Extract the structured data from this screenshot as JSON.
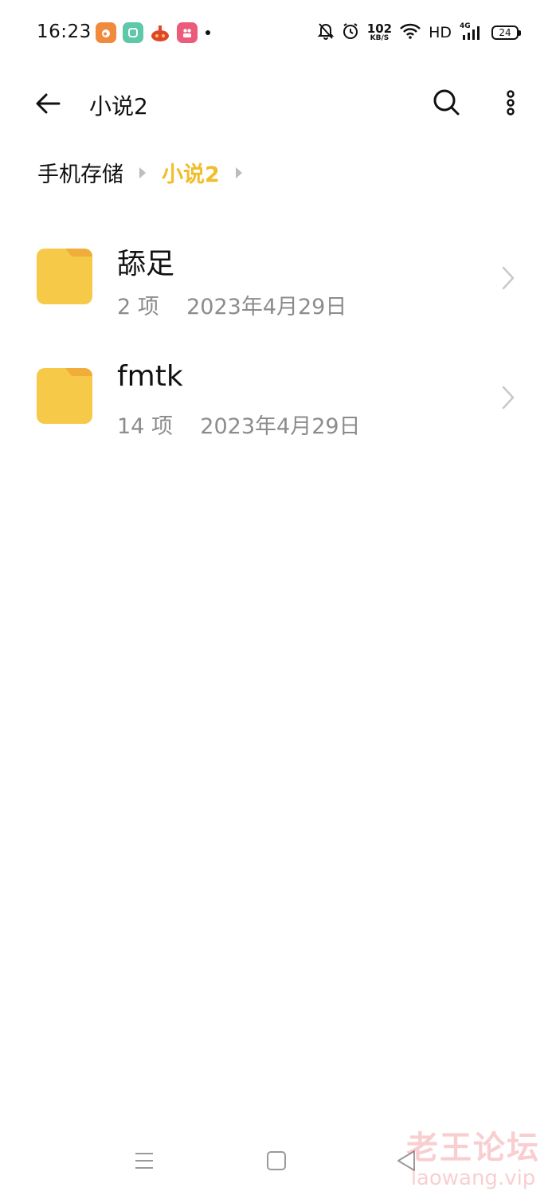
{
  "status_bar": {
    "time": "16:23",
    "notification_icons": [
      "weibo-app-icon",
      "green-app-icon",
      "red-game-icon",
      "pink-app-icon"
    ],
    "net_speed_value": "102",
    "net_speed_unit": "KB/S",
    "hd_label": "HD",
    "signal_type": "4G",
    "battery_level": "24",
    "icons": [
      "bell-off-icon",
      "alarm-icon",
      "wifi-icon",
      "signal-icon",
      "battery-icon"
    ]
  },
  "header": {
    "title": "小说2",
    "back_icon": "back-arrow-icon",
    "search_icon": "search-icon",
    "more_icon": "more-vertical-icon"
  },
  "breadcrumb": {
    "items": [
      "手机存储",
      "小说2"
    ]
  },
  "files": [
    {
      "name": "舔足",
      "count": "2 项",
      "date": "2023年4月29日"
    },
    {
      "name": "fmtk",
      "count": "14 项",
      "date": "2023年4月29日"
    }
  ],
  "nav_bar": {
    "icons": [
      "menu-icon",
      "home-icon",
      "back-triangle-icon"
    ]
  },
  "watermark": {
    "cn": "老王论坛",
    "en": "laowang.vip"
  },
  "colors": {
    "accent": "#f2bd2c",
    "folder": "#f7c948",
    "folder_tab": "#f0ad3a",
    "meta_text": "#8c8c8c"
  }
}
